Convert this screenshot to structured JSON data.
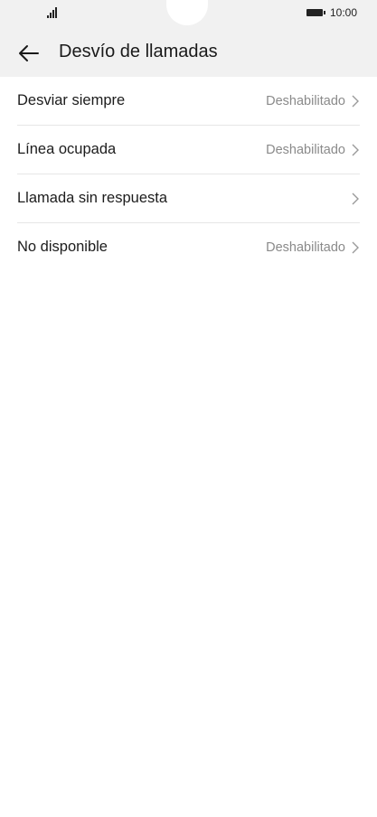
{
  "status": {
    "time": "10:00"
  },
  "header": {
    "title": "Desvío de llamadas"
  },
  "list": {
    "items": [
      {
        "label": "Desviar siempre",
        "value": "Deshabilitado"
      },
      {
        "label": "Línea ocupada",
        "value": "Deshabilitado"
      },
      {
        "label": "Llamada sin respuesta",
        "value": ""
      },
      {
        "label": "No disponible",
        "value": "Deshabilitado"
      }
    ]
  },
  "icons": {
    "back": "arrow-left-icon",
    "chevron": "chevron-right-icon",
    "signal": "signal-icon",
    "battery": "battery-icon"
  },
  "colors": {
    "header_bg": "#f1f1f1",
    "text_primary": "#1c1c1c",
    "text_secondary": "#8a8a8a",
    "divider": "#e6e6e6"
  }
}
